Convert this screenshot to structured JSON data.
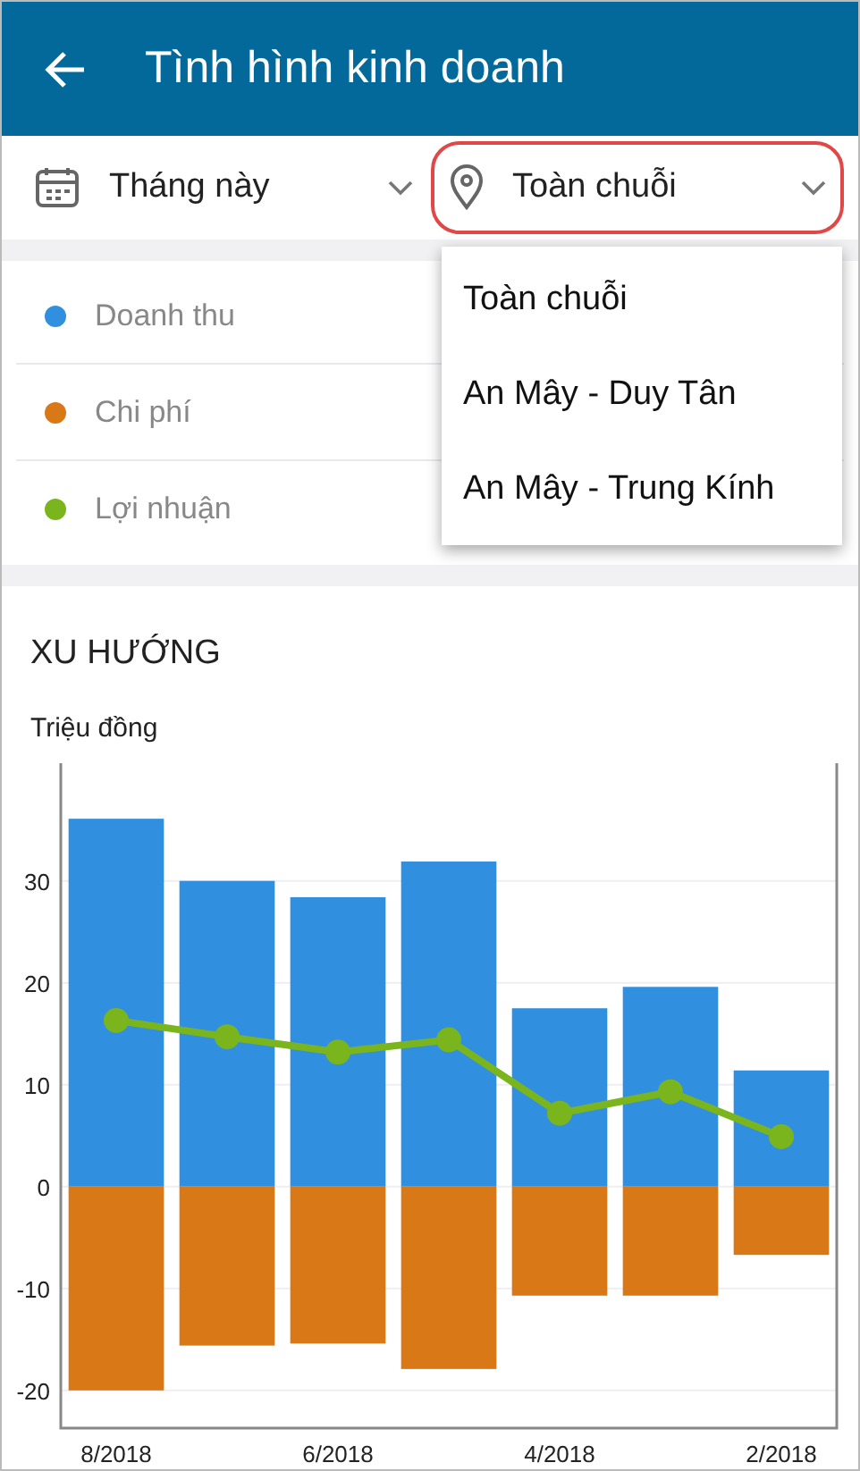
{
  "header": {
    "title": "Tình hình kinh doanh"
  },
  "filters": [
    {
      "kind": "date",
      "label": "Tháng này",
      "highlighted": false
    },
    {
      "kind": "location",
      "label": "Toàn chuỗi",
      "highlighted": true
    }
  ],
  "dropdown": {
    "items": [
      {
        "label": "Toàn chuỗi"
      },
      {
        "label": "An Mây - Duy Tân"
      },
      {
        "label": "An Mây - Trung Kính"
      }
    ]
  },
  "trend": {
    "title": "XU HƯỚNG",
    "unit": "Triệu đồng",
    "chart_data": {
      "type": "bar",
      "stacked": true,
      "grid": true,
      "categories": [
        "8/2018",
        null,
        "6/2018",
        null,
        "4/2018",
        null,
        "2/2018"
      ],
      "yticks": [
        -20,
        -10,
        0,
        10,
        20,
        30
      ],
      "ylim": [
        -23.7,
        41.55
      ],
      "series": [
        {
          "name": "Doanh thu",
          "type": "bar",
          "color": "#318fdf",
          "values": [
            36.1,
            30,
            28.4,
            31.9,
            17.5,
            19.6,
            11.4
          ]
        },
        {
          "name": "Chi phí",
          "type": "bar",
          "color": "#d97817",
          "values": [
            -20,
            -15.6,
            -15.4,
            -17.9,
            -10.7,
            -10.7,
            -6.7
          ]
        },
        {
          "name": "Lợi nhuận",
          "type": "line",
          "marker": true,
          "color": "#7ab51d",
          "values": [
            16.3,
            14.7,
            13.2,
            14.4,
            7.2,
            9.3,
            4.9
          ]
        }
      ]
    }
  }
}
